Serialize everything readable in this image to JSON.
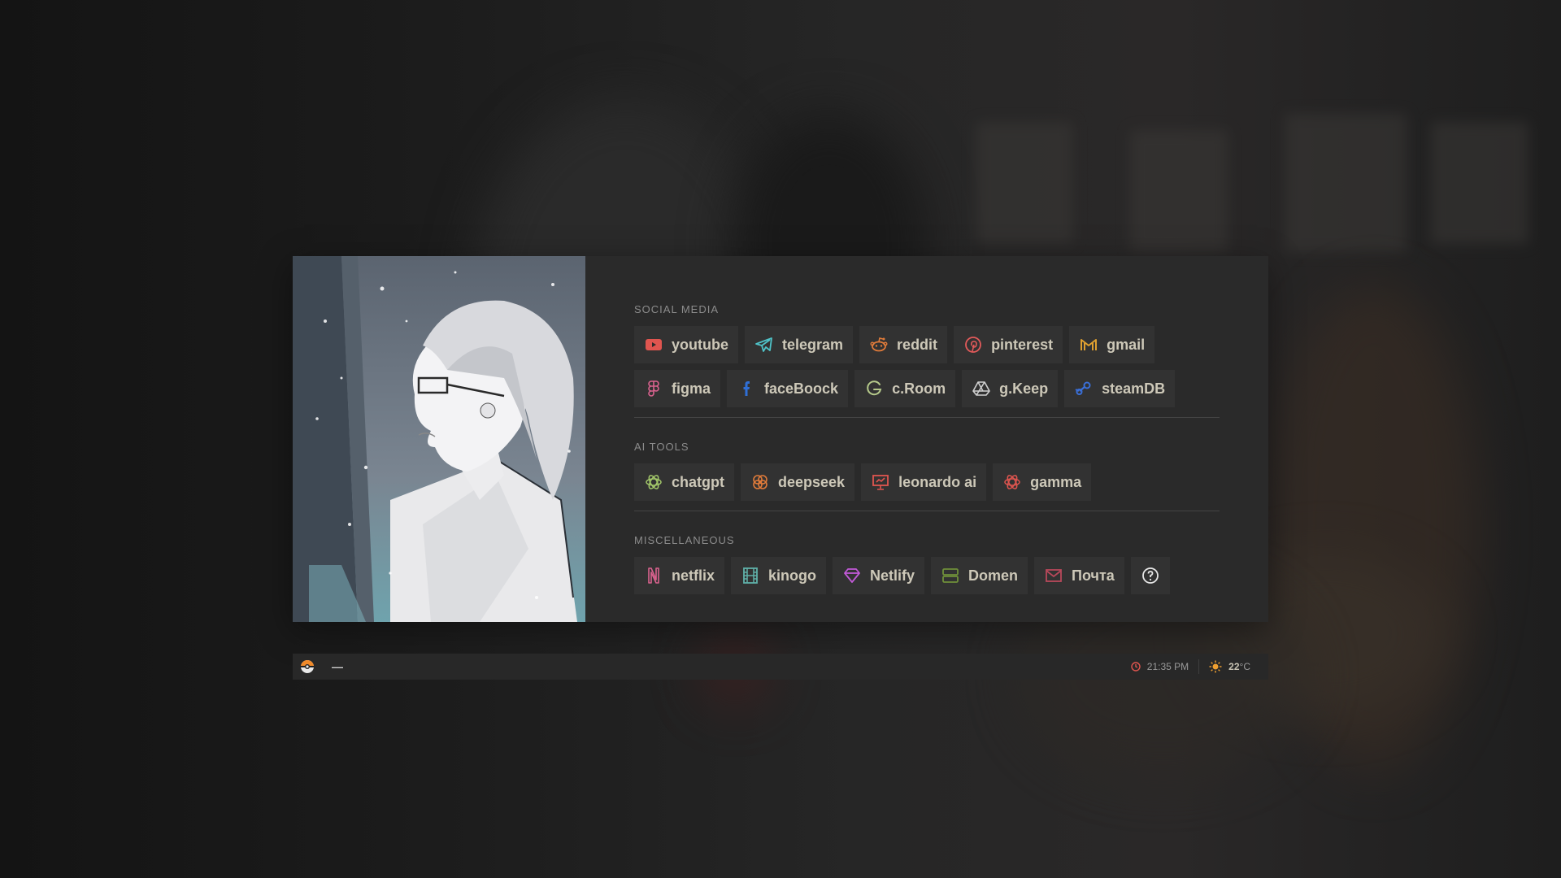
{
  "sections": [
    {
      "title": "SOCIAL MEDIA",
      "rows": [
        [
          {
            "label": "youtube",
            "icon": "youtube-icon",
            "color": "#e0554f"
          },
          {
            "label": "telegram",
            "icon": "telegram-icon",
            "color": "#4fc3c8"
          },
          {
            "label": "reddit",
            "icon": "reddit-icon",
            "color": "#e07b3a"
          },
          {
            "label": "pinterest",
            "icon": "pinterest-icon",
            "color": "#e25a5a"
          },
          {
            "label": "gmail",
            "icon": "gmail-icon",
            "color": "#e0a030"
          }
        ],
        [
          {
            "label": "figma",
            "icon": "figma-icon",
            "color": "#d9628e"
          },
          {
            "label": "faceBoock",
            "icon": "facebook-icon",
            "color": "#2f6fd6"
          },
          {
            "label": "c.Room",
            "icon": "google-icon",
            "color": "#b5c98a"
          },
          {
            "label": "g.Keep",
            "icon": "google-drive-icon",
            "color": "#cfcfcf"
          },
          {
            "label": "steamDB",
            "icon": "steam-icon",
            "color": "#3a6fd8"
          }
        ]
      ]
    },
    {
      "title": "AI TOOLS",
      "rows": [
        [
          {
            "label": "chatgpt",
            "icon": "openai-icon",
            "color": "#a3c86a"
          },
          {
            "label": "deepseek",
            "icon": "deepseek-icon",
            "color": "#e07b3a"
          },
          {
            "label": "leonardo ai",
            "icon": "presentation-icon",
            "color": "#e0554f"
          },
          {
            "label": "gamma",
            "icon": "gamma-icon",
            "color": "#e0554f"
          }
        ]
      ]
    },
    {
      "title": "MISCELLANEOUS",
      "rows": [
        [
          {
            "label": "netflix",
            "icon": "netflix-icon",
            "color": "#d9628e"
          },
          {
            "label": "kinogo",
            "icon": "film-icon",
            "color": "#5fb0a8"
          },
          {
            "label": "Netlify",
            "icon": "diamond-icon",
            "color": "#c25ad8"
          },
          {
            "label": "Domen",
            "icon": "server-icon",
            "color": "#6f8f3a"
          },
          {
            "label": "Почта",
            "icon": "mail-icon",
            "color": "#b8485a"
          },
          {
            "label": "",
            "icon": "help-icon",
            "color": "#e6e6e6"
          }
        ]
      ]
    }
  ],
  "taskbar": {
    "left_symbol": "—",
    "time": "21:35 PM",
    "temperature": "22",
    "temp_unit": "°C",
    "clock_color": "#e0554f",
    "sun_color": "#f0a030"
  }
}
